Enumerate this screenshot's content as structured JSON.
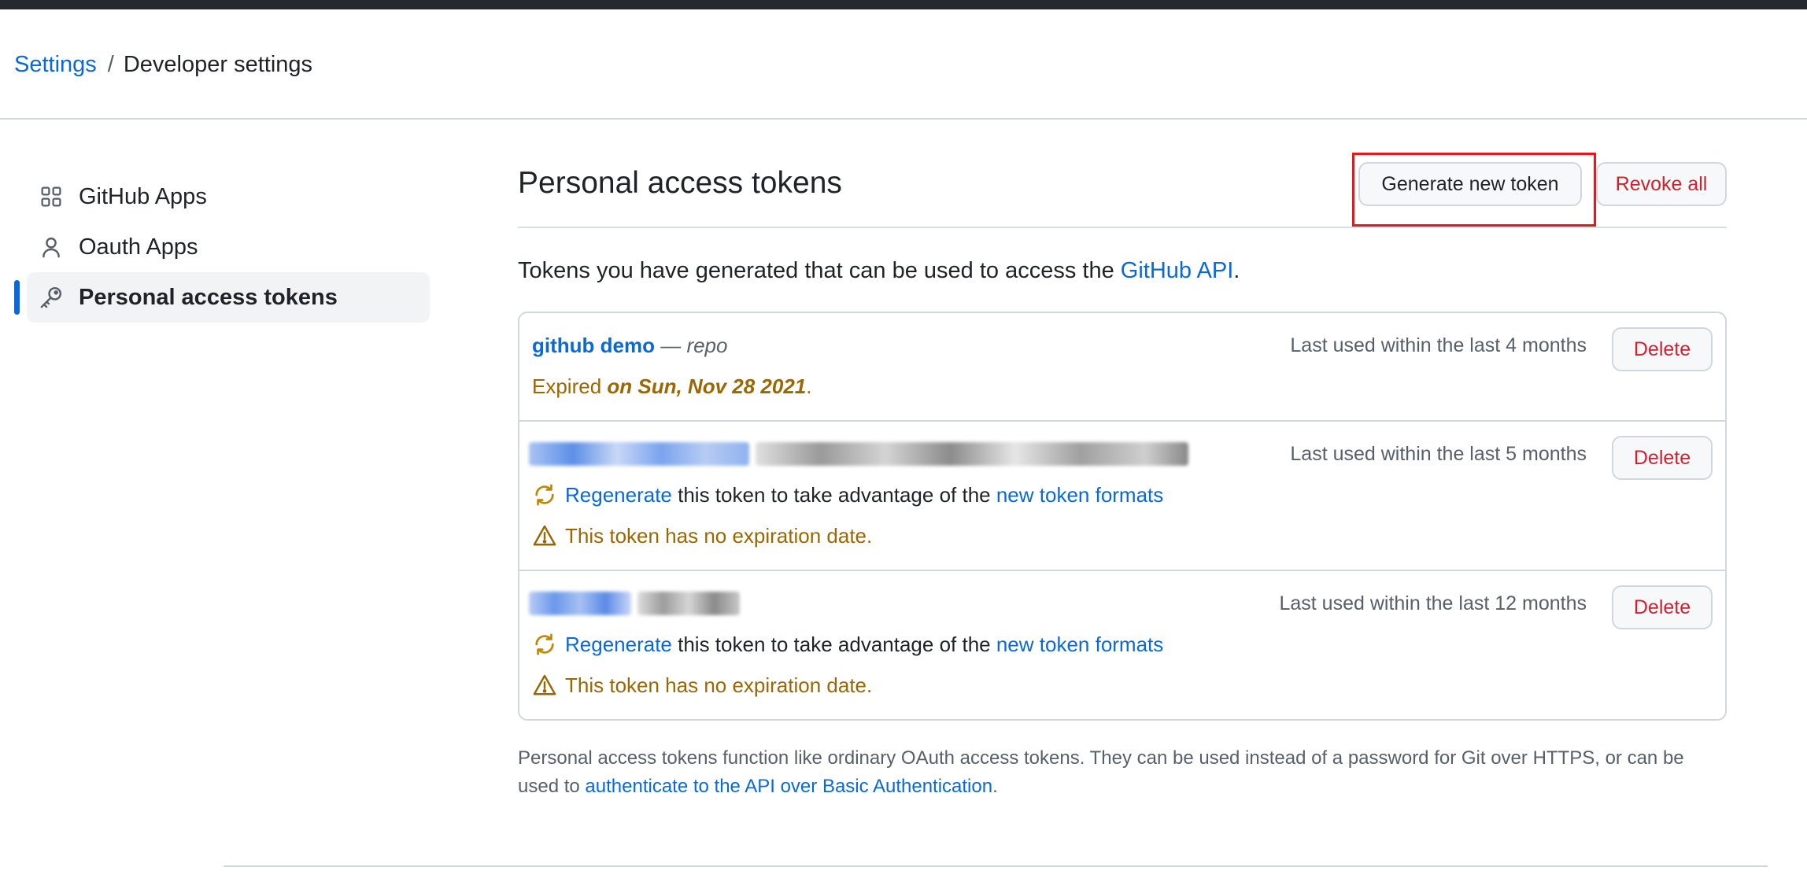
{
  "breadcrumb": {
    "settings": "Settings",
    "separator": "/",
    "current": "Developer settings"
  },
  "sidebar": {
    "items": [
      {
        "label": "GitHub Apps",
        "icon": "apps-grid-icon",
        "selected": false
      },
      {
        "label": "Oauth Apps",
        "icon": "person-icon",
        "selected": false
      },
      {
        "label": "Personal access tokens",
        "icon": "key-icon",
        "selected": true
      }
    ]
  },
  "main": {
    "title": "Personal access tokens",
    "generate_label": "Generate new token",
    "revoke_label": "Revoke all",
    "intro_text": "Tokens you have generated that can be used to access the ",
    "intro_link": "GitHub API",
    "intro_end": "."
  },
  "tokens": [
    {
      "name": "github demo",
      "scope_sep": " — ",
      "scope": "repo",
      "expired_prefix": "Expired ",
      "expired_date": "on Sun, Nov 28 2021",
      "expired_suffix": ".",
      "last_used": "Last used within the last 4 months",
      "delete_label": "Delete"
    },
    {
      "regen_link": "Regenerate",
      "regen_text": " this token to take advantage of the ",
      "formats_link": "new token formats",
      "warning": "This token has no expiration date.",
      "last_used": "Last used within the last 5 months",
      "delete_label": "Delete"
    },
    {
      "regen_link": "Regenerate",
      "regen_text": " this token to take advantage of the ",
      "formats_link": "new token formats",
      "warning": "This token has no expiration date.",
      "last_used": "Last used within the last 12 months",
      "delete_label": "Delete"
    }
  ],
  "footer": {
    "text": "Personal access tokens function like ordinary OAuth access tokens. They can be used instead of a password for Git over HTTPS, or can be used to ",
    "link": "authenticate to the API over Basic Authentication",
    "end": "."
  },
  "colors": {
    "link": "#0969da",
    "danger": "#cf222e",
    "warning": "#9a6700",
    "highlight": "#e5191d"
  }
}
